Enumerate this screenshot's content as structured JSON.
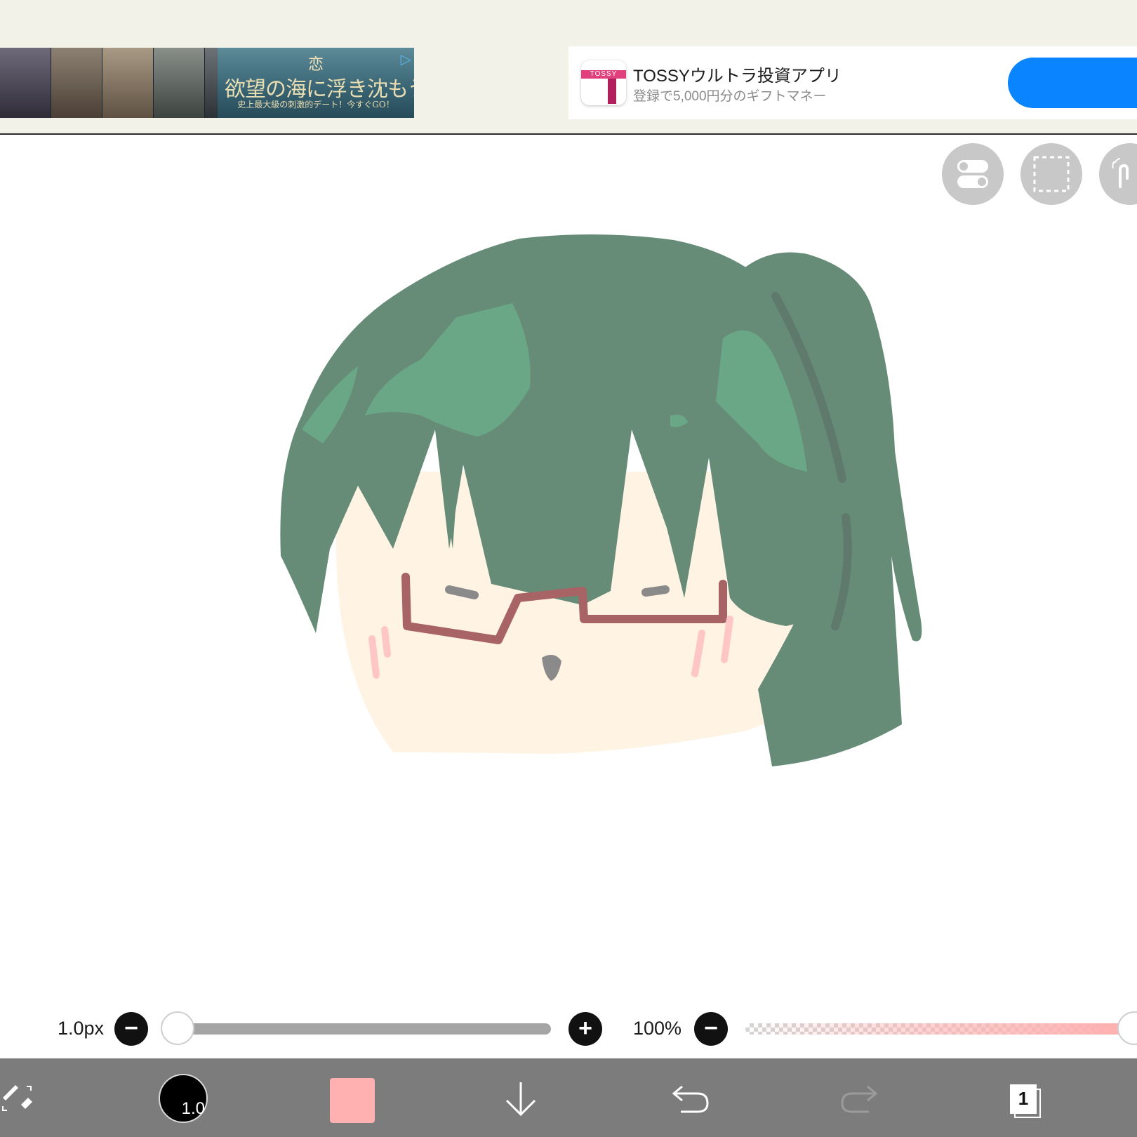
{
  "ad_top": {
    "banner_title": "欲望の海に浮き沈もう",
    "banner_sub": "史上最大級の刺激的デート！今すぐGO！",
    "banner_logo": "恋"
  },
  "ad_right": {
    "icon_text": "TOSSY",
    "title": "TOSSYウルトラ投資アプリ",
    "subtitle": "登録で5,000円分のギフトマネー"
  },
  "tools_top": [
    "toggle-icon",
    "selection-icon",
    "hand-icon"
  ],
  "brush": {
    "size_label": "1.0px",
    "size_value": 1.0,
    "opacity_label": "100%",
    "opacity_value": 1.0,
    "color": "#ffb1b1"
  },
  "toolbar": {
    "brush_size_badge": "1.0",
    "layer_count": "1"
  },
  "colors": {
    "hair": "#668c78",
    "hair_highlight": "#6aa786",
    "skin": "#fff3e3",
    "glasses": "#a86464",
    "blush": "#ffc6c8",
    "accent_blue": "#0a84ff"
  }
}
